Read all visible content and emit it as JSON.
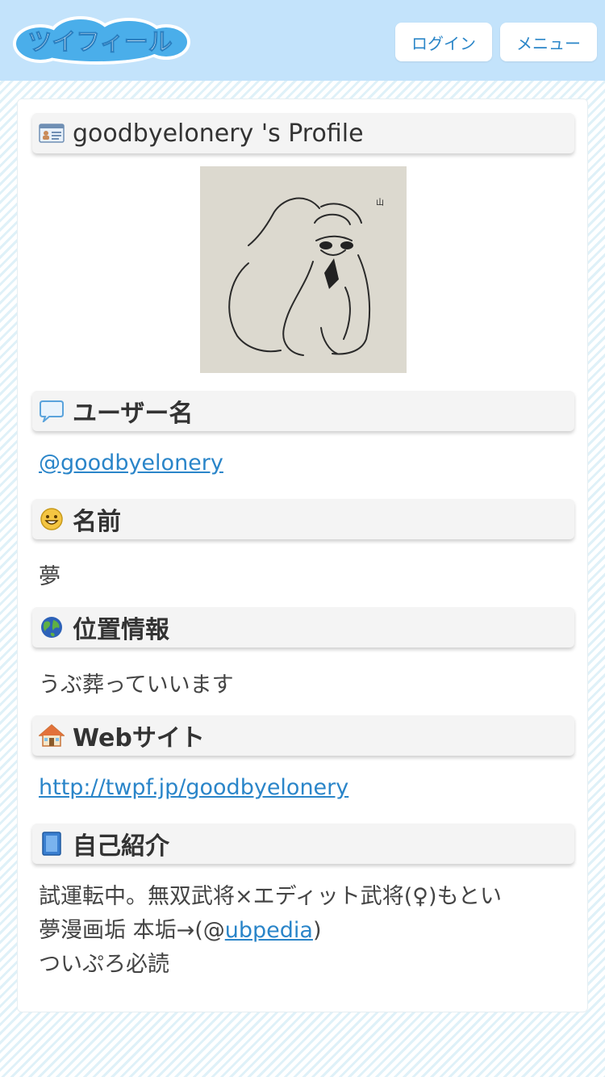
{
  "header": {
    "logo_text": "ツイフィール",
    "login_label": "ログイン",
    "menu_label": "メニュー"
  },
  "profile": {
    "title": "goodbyelonery 's Profile"
  },
  "sections": {
    "username": {
      "label": "ユーザー名",
      "value": "@goodbyelonery"
    },
    "name": {
      "label": "名前",
      "value": "夢"
    },
    "location": {
      "label": "位置情報",
      "value": "うぶ葬っていいます"
    },
    "website": {
      "label": "Webサイト",
      "value": "http://twpf.jp/goodbyelonery"
    },
    "bio": {
      "label": "自己紹介",
      "line1": "試運転中。無双武将×エディット武将(♀)もとい",
      "line2_pre": "夢漫画垢 本垢→(@",
      "line2_link": "ubpedia",
      "line2_post": ")",
      "line3": "ついぷろ必読"
    }
  },
  "icons": {
    "profile": "id-card-icon",
    "username": "speech-bubble-icon",
    "name": "smiley-icon",
    "location": "globe-icon",
    "website": "house-icon",
    "bio": "book-icon"
  },
  "colors": {
    "header_bg": "#c3e3fb",
    "link": "#2a85c9",
    "logo": "#3fa6e8"
  }
}
